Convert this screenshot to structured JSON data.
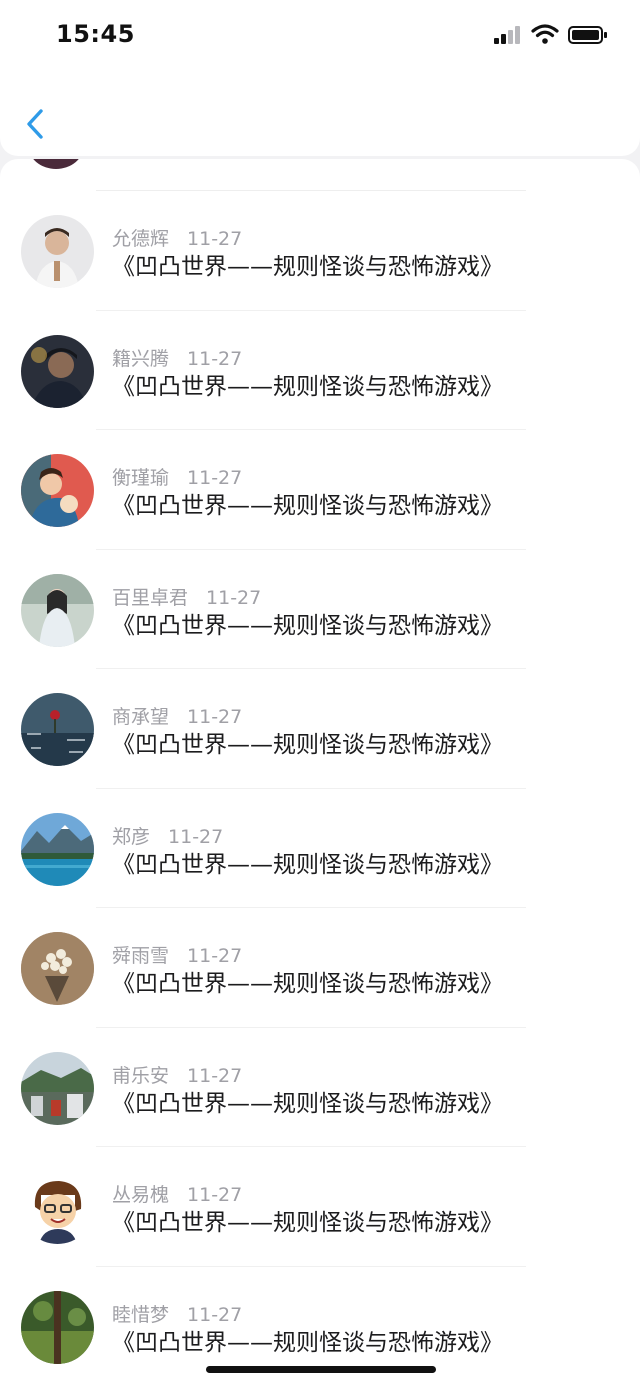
{
  "status_bar": {
    "time": "15:45",
    "icons": [
      "signal-icon",
      "wifi-icon",
      "battery-icon"
    ]
  },
  "nav": {
    "back_icon": "chevron-left-icon",
    "accent": "#2f9be8"
  },
  "items": [
    {
      "name": "允德辉",
      "date": "11-27",
      "title": "《凹凸世界——规则怪谈与恐怖游戏》",
      "avatar": "person-photo"
    },
    {
      "name": "籍兴腾",
      "date": "11-27",
      "title": "《凹凸世界——规则怪谈与恐怖游戏》",
      "avatar": "person-photo"
    },
    {
      "name": "衡瑾瑜",
      "date": "11-27",
      "title": "《凹凸世界——规则怪谈与恐怖游戏》",
      "avatar": "illustration"
    },
    {
      "name": "百里卓君",
      "date": "11-27",
      "title": "《凹凸世界——规则怪谈与恐怖游戏》",
      "avatar": "person-photo"
    },
    {
      "name": "商承望",
      "date": "11-27",
      "title": "《凹凸世界——规则怪谈与恐怖游戏》",
      "avatar": "rose-photo"
    },
    {
      "name": "郑彦",
      "date": "11-27",
      "title": "《凹凸世界——规则怪谈与恐怖游戏》",
      "avatar": "landscape-photo"
    },
    {
      "name": "舜雨雪",
      "date": "11-27",
      "title": "《凹凸世界——规则怪谈与恐怖游戏》",
      "avatar": "flowers-photo"
    },
    {
      "name": "甫乐安",
      "date": "11-27",
      "title": "《凹凸世界——规则怪谈与恐怖游戏》",
      "avatar": "city-photo"
    },
    {
      "name": "丛易槐",
      "date": "11-27",
      "title": "《凹凸世界——规则怪谈与恐怖游戏》",
      "avatar": "cartoon-avatar"
    },
    {
      "name": "睦惜梦",
      "date": "11-27",
      "title": "《凹凸世界——规则怪谈与恐怖游戏》",
      "avatar": "nature-photo"
    }
  ]
}
